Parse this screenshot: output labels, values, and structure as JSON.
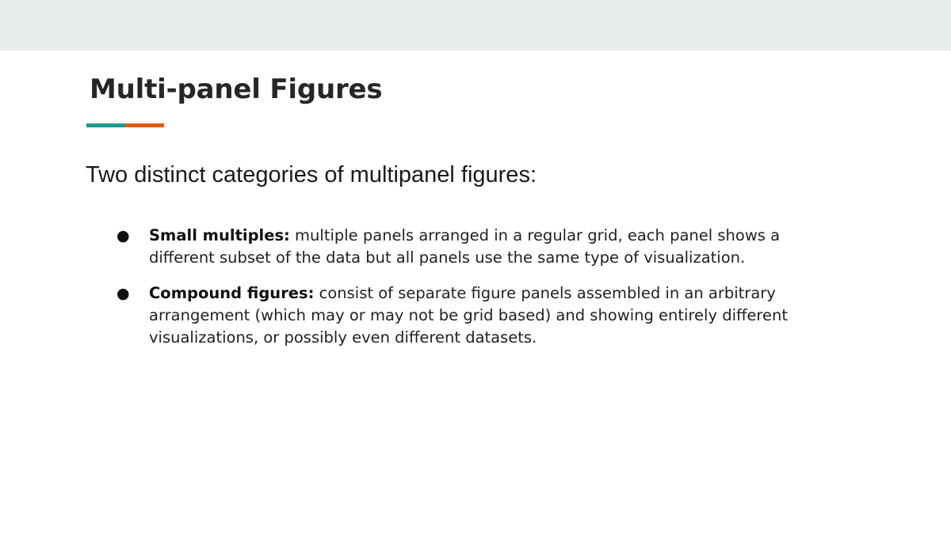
{
  "slide": {
    "title": "Multi-panel Figures",
    "subtitle": "Two distinct categories of multipanel figures:",
    "accent_colors": {
      "teal": "#1a9c8f",
      "orange": "#e35a10",
      "top_band": "#e8ebeb"
    },
    "bullets": [
      {
        "marker": "●",
        "term": "Small multiples:",
        "text": " multiple panels arranged in a regular grid, each panel shows a different subset of the data but all panels use the same type of visualization."
      },
      {
        "marker": "●",
        "term": "Compound figures:",
        "text": " consist of separate figure panels assembled in an arbitrary arrangement (which may or may not be grid based) and showing entirely different visualizations, or possibly even different datasets."
      }
    ]
  }
}
